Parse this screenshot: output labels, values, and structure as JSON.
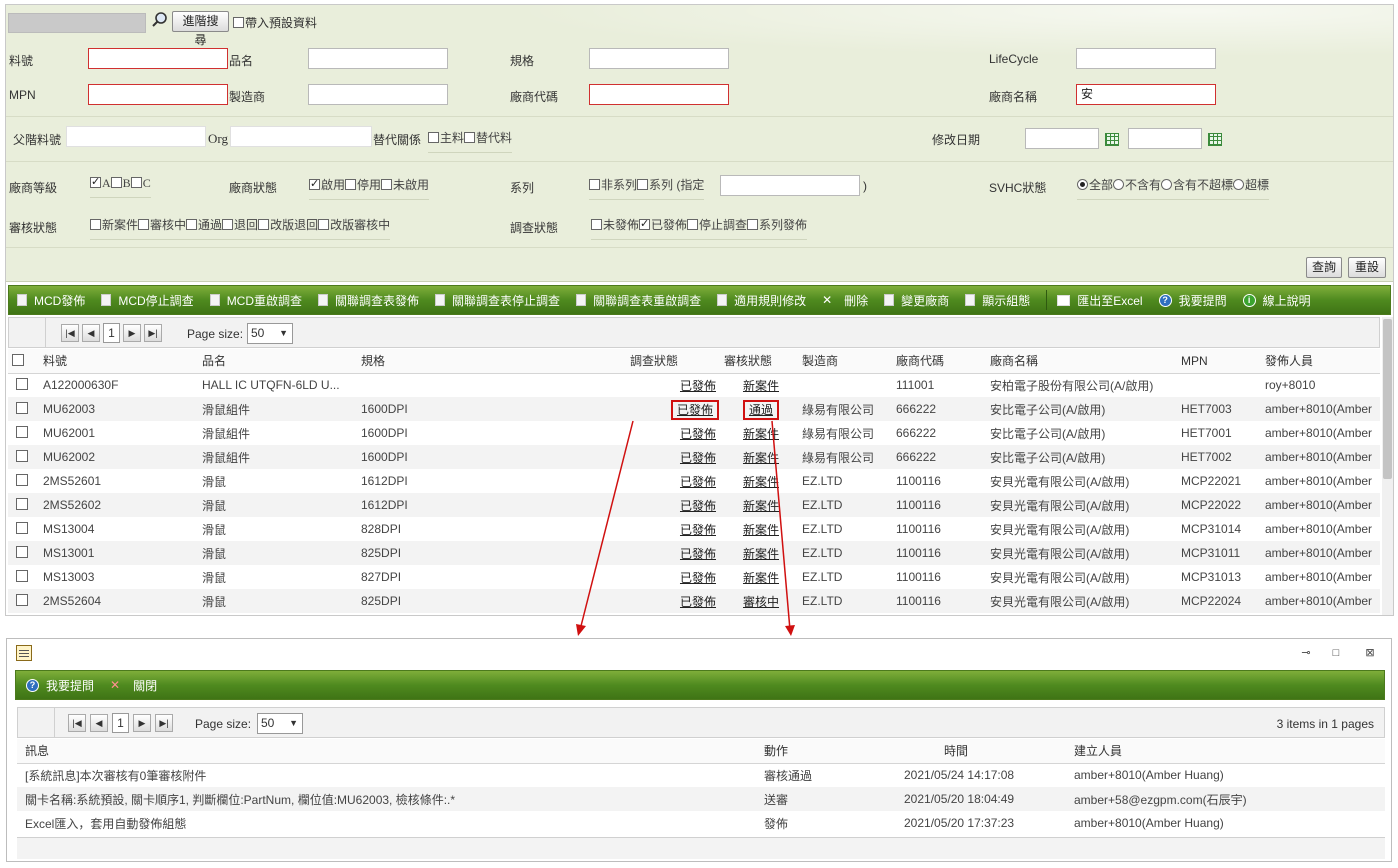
{
  "search": {
    "advanced_btn": "進階搜尋",
    "preset_label": "帶入預設資料",
    "labels": {
      "part_no": "料號",
      "part_name": "品名",
      "spec": "規格",
      "lifecycle": "LifeCycle",
      "mpn": "MPN",
      "maker": "製造商",
      "vendor_code": "廠商代碼",
      "vendor_name": "廠商名稱",
      "parent_no": "父階料號",
      "org": "Org",
      "alt_rel": "替代關係",
      "modified_date": "修改日期",
      "vendor_grade": "廠商等級",
      "vendor_status": "廠商狀態",
      "series": "系列",
      "svhc": "SVHC狀態",
      "review_status": "審核狀態",
      "survey_status": "調查狀態"
    },
    "vendor_name_value": "安",
    "alt_rel_opts": [
      "主料",
      "替代料"
    ],
    "grade_opts": [
      "A",
      "B",
      "C"
    ],
    "vendor_status_opts": [
      "啟用",
      "停用",
      "未啟用"
    ],
    "series_opts": [
      "非系列",
      "系列 (指定"
    ],
    "series_close": ")",
    "svhc_opts": [
      "全部",
      "不含有",
      "含有不超標",
      "超標"
    ],
    "review_opts": [
      "新案件",
      "審核中",
      "通過",
      "退回",
      "改版退回",
      "改版審核中"
    ],
    "survey_opts": [
      "未發佈",
      "已發佈",
      "停止調查",
      "系列發佈"
    ],
    "query_btn": "查詢",
    "reset_btn": "重設"
  },
  "toolbar": {
    "items": [
      "MCD發佈",
      "MCD停止調查",
      "MCD重啟調查",
      "關聯調查表發佈",
      "關聯調查表停止調查",
      "關聯調查表重啟調查",
      "適用規則修改",
      "刪除",
      "變更廠商",
      "顯示組態",
      "匯出至Excel",
      "我要提問",
      "線上說明"
    ]
  },
  "grid": {
    "page": "1",
    "page_size_label": "Page size:",
    "page_size": "50",
    "headers": [
      "料號",
      "品名",
      "規格",
      "調查狀態",
      "審核狀態",
      "製造商",
      "廠商代碼",
      "廠商名稱",
      "MPN",
      "發佈人員"
    ],
    "rows": [
      [
        "A122000630F",
        "HALL IC UTQFN-6LD U...",
        "",
        "已發佈",
        "新案件",
        "",
        "111001",
        "安柏電子股份有限公司(A/啟用)",
        "",
        "roy+8010"
      ],
      [
        "MU62003",
        "滑鼠組件",
        "1600DPI",
        "已發佈",
        "通過",
        "綠易有限公司",
        "666222",
        "安比電子公司(A/啟用)",
        "HET7003",
        "amber+8010(Amber"
      ],
      [
        "MU62001",
        "滑鼠組件",
        "1600DPI",
        "已發佈",
        "新案件",
        "綠易有限公司",
        "666222",
        "安比電子公司(A/啟用)",
        "HET7001",
        "amber+8010(Amber"
      ],
      [
        "MU62002",
        "滑鼠組件",
        "1600DPI",
        "已發佈",
        "新案件",
        "綠易有限公司",
        "666222",
        "安比電子公司(A/啟用)",
        "HET7002",
        "amber+8010(Amber"
      ],
      [
        "2MS52601",
        "滑鼠",
        "1612DPI",
        "已發佈",
        "新案件",
        "EZ.LTD",
        "1100116",
        "安貝光電有限公司(A/啟用)",
        "MCP22021",
        "amber+8010(Amber"
      ],
      [
        "2MS52602",
        "滑鼠",
        "1612DPI",
        "已發佈",
        "新案件",
        "EZ.LTD",
        "1100116",
        "安貝光電有限公司(A/啟用)",
        "MCP22022",
        "amber+8010(Amber"
      ],
      [
        "MS13004",
        "滑鼠",
        "828DPI",
        "已發佈",
        "新案件",
        "EZ.LTD",
        "1100116",
        "安貝光電有限公司(A/啟用)",
        "MCP31014",
        "amber+8010(Amber"
      ],
      [
        "MS13001",
        "滑鼠",
        "825DPI",
        "已發佈",
        "新案件",
        "EZ.LTD",
        "1100116",
        "安貝光電有限公司(A/啟用)",
        "MCP31011",
        "amber+8010(Amber"
      ],
      [
        "MS13003",
        "滑鼠",
        "827DPI",
        "已發佈",
        "新案件",
        "EZ.LTD",
        "1100116",
        "安貝光電有限公司(A/啟用)",
        "MCP31013",
        "amber+8010(Amber"
      ],
      [
        "2MS52604",
        "滑鼠",
        "825DPI",
        "已發佈",
        "審核中",
        "EZ.LTD",
        "1100116",
        "安貝光電有限公司(A/啟用)",
        "MCP22024",
        "amber+8010(Amber"
      ]
    ]
  },
  "popup": {
    "toolbar": [
      "我要提問",
      "關閉"
    ],
    "page": "1",
    "page_size_label": "Page size:",
    "page_size": "50",
    "items_info": "3 items in 1 pages",
    "headers": [
      "訊息",
      "動作",
      "時間",
      "建立人員"
    ],
    "rows": [
      [
        "[系統訊息]本次審核有0筆審核附件",
        "審核通過",
        "2021/05/24 14:17:08",
        "amber+8010(Amber Huang)"
      ],
      [
        "關卡名稱:系統預設, 關卡順序1, 判斷欄位:PartNum, 欄位值:MU62003, 檢核條件:.*",
        "送審",
        "2021/05/20 18:04:49",
        "amber+58@ezgpm.com(石辰宇)"
      ],
      [
        "Excel匯入，套用自動發佈組態",
        "發佈",
        "2021/05/20 17:37:23",
        "amber+8010(Amber Huang)"
      ]
    ]
  },
  "colors": {
    "toolbar_green": "#4f8a1f",
    "highlight_red": "#d01010",
    "search_bg": "#e9eedb"
  }
}
